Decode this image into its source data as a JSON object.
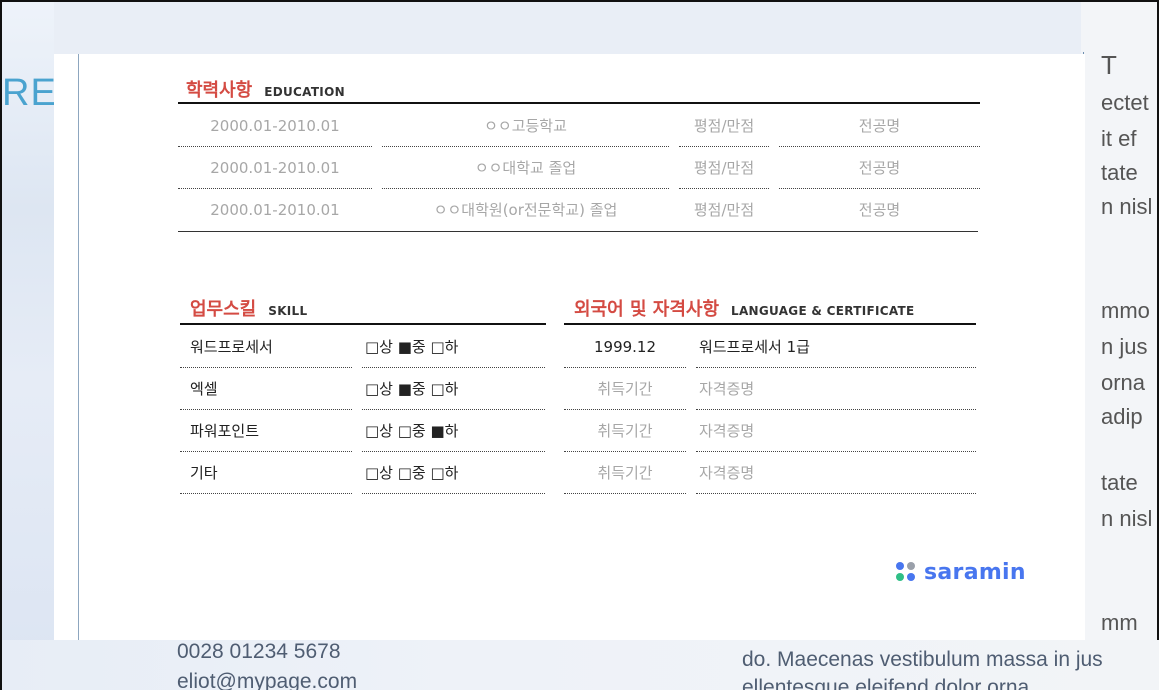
{
  "background": {
    "left_fragment": "RE",
    "right_fragments": [
      "T",
      "ectet",
      "it ef",
      "tate",
      "n nisl",
      "mmo",
      "n jus",
      "orna",
      "adip",
      "tate",
      "n nisl",
      "mm"
    ],
    "phone": "0028 01234 5678",
    "email": "eliot@mypage.com",
    "paragraph_line1": "do. Maecenas vestibulum massa in jus",
    "paragraph_line2": "ellentesque eleifend dolor orna"
  },
  "education": {
    "title_ko": "학력사항",
    "title_en": "EDUCATION",
    "rows": [
      {
        "period": "2000.01-2010.01",
        "school": "ㅇㅇ고등학교",
        "gpa": "평점/만점",
        "major": "전공명"
      },
      {
        "period": "2000.01-2010.01",
        "school": "ㅇㅇ대학교 졸업",
        "gpa": "평점/만점",
        "major": "전공명"
      },
      {
        "period": "2000.01-2010.01",
        "school": "ㅇㅇ대학원(or전문학교) 졸업",
        "gpa": "평점/만점",
        "major": "전공명"
      }
    ]
  },
  "skill": {
    "title_ko": "업무스킬",
    "title_en": "SKILL",
    "rows": [
      {
        "name": "워드프로세서",
        "level": "□상 ■중 □하"
      },
      {
        "name": "엑셀",
        "level": "□상 ■중 □하"
      },
      {
        "name": "파워포인트",
        "level": "□상 □중 ■하"
      },
      {
        "name": "기타",
        "level": "□상 □중 □하"
      }
    ]
  },
  "certificate": {
    "title_ko": "외국어 및 자격사항",
    "title_en": "LANGUAGE & CERTIFICATE",
    "rows": [
      {
        "date": "1999.12",
        "name": "워드프로세서 1급",
        "filled": true
      },
      {
        "date": "취득기간",
        "name": "자격증명",
        "filled": false
      },
      {
        "date": "취득기간",
        "name": "자격증명",
        "filled": false
      },
      {
        "date": "취득기간",
        "name": "자격증명",
        "filled": false
      }
    ]
  },
  "logo": {
    "text": "saramin",
    "dot_colors": [
      "#4876ef",
      "#9aa0aa",
      "#2fbf86",
      "#4876ef"
    ]
  },
  "colors": {
    "section_title": "#d44b43",
    "placeholder_text": "#a7a7a7",
    "brand": "#4876ef"
  }
}
